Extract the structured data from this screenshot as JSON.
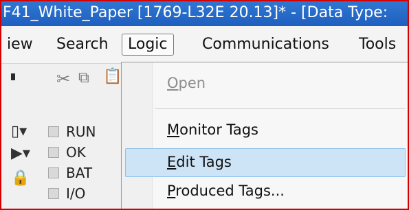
{
  "title_bar": {
    "text": "F41_White_Paper [1769-L32E 20.13]* - [Data Type:"
  },
  "menubar": {
    "items": [
      {
        "label": "iew"
      },
      {
        "label": "Search"
      },
      {
        "label": "Logic"
      },
      {
        "label": "Communications"
      },
      {
        "label": "Tools"
      }
    ]
  },
  "toolbar": {
    "icons": [
      "cut-icon",
      "copy-icon",
      "paste-icon"
    ]
  },
  "status": {
    "items": [
      {
        "label": "RUN"
      },
      {
        "label": "OK"
      },
      {
        "label": "BAT"
      },
      {
        "label": "I/O"
      }
    ]
  },
  "logic_menu": {
    "items": [
      {
        "mnemonic": "O",
        "rest": "pen",
        "enabled": false
      },
      {
        "mnemonic": "M",
        "rest": "onitor Tags",
        "enabled": true
      },
      {
        "mnemonic": "E",
        "rest": "dit Tags",
        "enabled": true,
        "highlighted": true
      },
      {
        "mnemonic": "P",
        "rest": "roduced Tags...",
        "enabled": true
      }
    ]
  },
  "colors": {
    "title_bar": "#1f5fbf",
    "highlight": "#cde4f7",
    "frame_border": "#d40000"
  }
}
